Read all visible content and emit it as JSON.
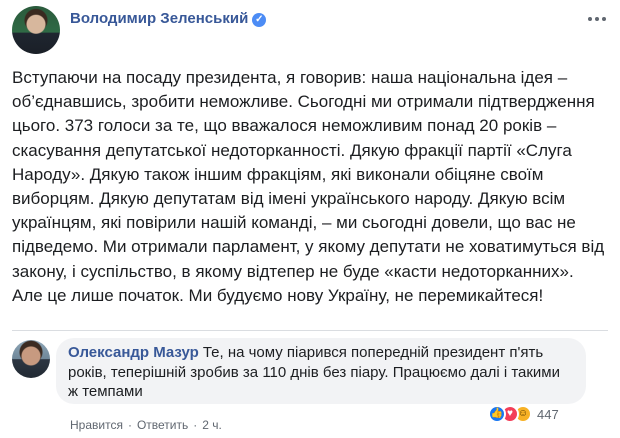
{
  "post": {
    "author": "Володимир Зеленський",
    "verified_icon": "✓",
    "text": "Вступаючи на посаду президента, я говорив: наша національна ідея – об’єднавшись, зробити неможливе. Сьогодні ми отримали підтвердження цього. 373 голоси за те, що вважалося неможливим понад 20 років – скасування депутатської недоторканності. Дякую фракції партії «Слуга Народу». Дякую також іншим фракціям, які виконали обіцяне своїм виборцям. Дякую депутатам від імені українського народу. Дякую всім українцям, які повірили нашій команді, – ми сьогодні довели, що вас не підведемо. Ми отримали парламент, у якому депутати не ховатимуться від закону, і суспільство, в якому відтепер не буде «касти недоторканних». Але це лише початок. Ми будуємо нову Україну, не перемикайтеся!"
  },
  "comment": {
    "author": "Олександр Мазур",
    "text": "Те, на чому піарився попередній президент п'ять років, теперішній зробив за 110 днів без піару. Працюємо далі і такими ж темпами",
    "actions": {
      "like": "Нравится",
      "reply": "Ответить",
      "separator": "·",
      "time": "2 ч."
    },
    "reactions": {
      "icons": [
        "like-icon",
        "love-icon",
        "haha-icon"
      ],
      "count": "447"
    }
  },
  "colors": {
    "link": "#385898",
    "text": "#1c1e21",
    "muted": "#606770",
    "bubble": "#f2f3f5"
  }
}
